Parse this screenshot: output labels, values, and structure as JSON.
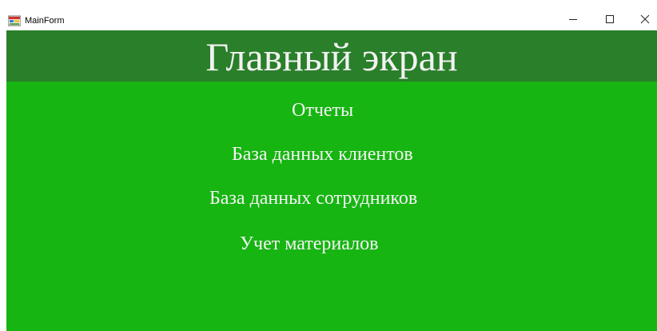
{
  "window": {
    "title": "MainForm",
    "icon": "winforms-app-icon",
    "controls": {
      "minimize_icon": "minimize-icon",
      "maximize_icon": "maximize-icon",
      "close_icon": "close-icon"
    }
  },
  "header": {
    "title": "Главный экран"
  },
  "menu": {
    "items": [
      {
        "label": "Отчеты"
      },
      {
        "label": "База данных клиентов"
      },
      {
        "label": "База данных сотрудников"
      },
      {
        "label": "Учет материалов"
      }
    ]
  },
  "colors": {
    "header_bg": "#2a7f2a",
    "content_bg": "#17b512",
    "text": "#f4f4f4"
  }
}
